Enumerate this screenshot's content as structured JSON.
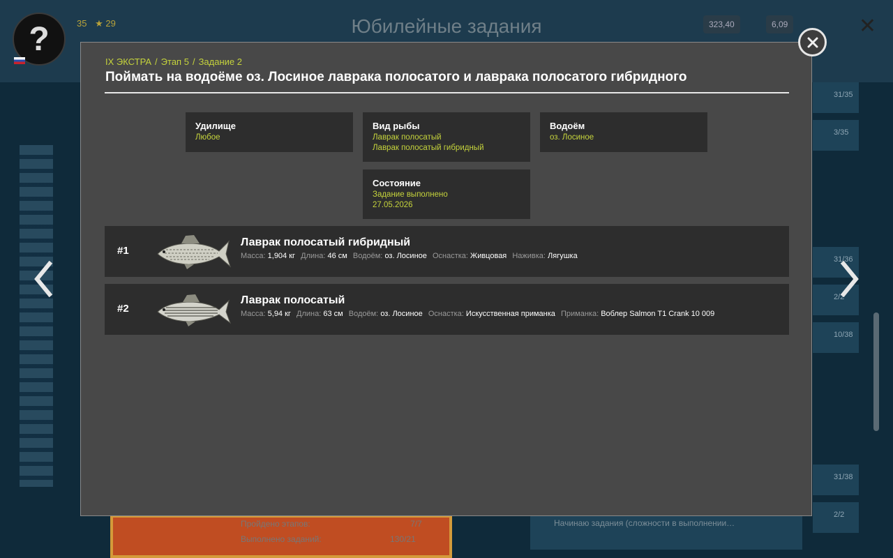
{
  "background": {
    "title": "Юбилейные задания",
    "wallet_silver": "323,40",
    "wallet_gold": "6,09",
    "avatar_glyph": "?",
    "level": "35",
    "rank": "29",
    "row_values": [
      "31/35",
      "3/35",
      "31/36",
      "2/2",
      "10/38",
      "31/38",
      "2/2"
    ],
    "card_lines": [
      "Пройдено этапов:",
      "Выполнено заданий:"
    ],
    "card_values": [
      "7/7",
      "130/21"
    ],
    "right_note": "Начинаю задания (сложности в выполнении…"
  },
  "nav": {
    "prev_icon": "chevron-left-icon",
    "next_icon": "chevron-right-icon"
  },
  "modal": {
    "breadcrumb": [
      "IX ЭКСТРА",
      "Этап 5",
      "Задание 2"
    ],
    "title": "Поймать на водоёме оз. Лосиное лаврака полосатого и лаврака полосатого гибридного",
    "info": {
      "rod": {
        "label": "Удилище",
        "value": "Любое"
      },
      "fish": {
        "label": "Вид рыбы",
        "values": [
          "Лаврак полосатый",
          "Лаврак полосатый гибридный"
        ]
      },
      "water": {
        "label": "Водоём",
        "value": "оз. Лосиное"
      },
      "status": {
        "label": "Состояние",
        "values": [
          "Задание выполнено",
          "27.05.2026"
        ]
      }
    },
    "catches": [
      {
        "num": "#1",
        "name": "Лаврак полосатый гибридный",
        "fields": [
          {
            "k": "Масса:",
            "v": "1,904 кг"
          },
          {
            "k": "Длина:",
            "v": "46 см"
          },
          {
            "k": "Водоём:",
            "v": "оз. Лосиное"
          },
          {
            "k": "Оснастка:",
            "v": "Живцовая"
          },
          {
            "k": "Наживка:",
            "v": "Лягушка"
          }
        ]
      },
      {
        "num": "#2",
        "name": "Лаврак полосатый",
        "fields": [
          {
            "k": "Масса:",
            "v": "5,94 кг"
          },
          {
            "k": "Длина:",
            "v": "63 см"
          },
          {
            "k": "Водоём:",
            "v": "оз. Лосиное"
          },
          {
            "k": "Оснастка:",
            "v": "Искусственная приманка"
          },
          {
            "k": "Приманка:",
            "v": "Воблер Salmon T1 Crank 10 009"
          }
        ]
      }
    ]
  },
  "colors": {
    "accent": "#c5d33c",
    "modal_bg": "#484848",
    "box_bg": "#2d2d2d"
  }
}
